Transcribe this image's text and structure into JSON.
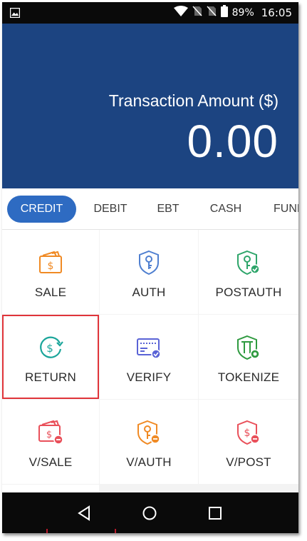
{
  "status_bar": {
    "battery_percent": "89%",
    "time": "16:05"
  },
  "header": {
    "amount_label": "Transaction Amount ($)",
    "amount_value": "0.00"
  },
  "tabs": [
    {
      "label": "CREDIT",
      "active": true
    },
    {
      "label": "DEBIT",
      "active": false
    },
    {
      "label": "EBT",
      "active": false
    },
    {
      "label": "CASH",
      "active": false
    },
    {
      "label": "FUNDING",
      "active": false
    }
  ],
  "actions": [
    {
      "label": "SALE",
      "icon": "wallet-dollar-icon",
      "color": "#f08a24"
    },
    {
      "label": "AUTH",
      "icon": "shield-key-icon",
      "color": "#4f7fd0"
    },
    {
      "label": "POSTAUTH",
      "icon": "shield-key-check-icon",
      "color": "#2ea56a"
    },
    {
      "label": "RETURN",
      "icon": "dollar-return-icon",
      "color": "#1aa59a",
      "selected": true
    },
    {
      "label": "VERIFY",
      "icon": "card-verify-icon",
      "color": "#5a63d6"
    },
    {
      "label": "TOKENIZE",
      "icon": "shield-token-icon",
      "color": "#2e9a3f"
    },
    {
      "label": "V/SALE",
      "icon": "wallet-void-icon",
      "color": "#e9505a"
    },
    {
      "label": "V/AUTH",
      "icon": "shield-key-void-icon",
      "color": "#f08a24"
    },
    {
      "label": "V/POST",
      "icon": "shield-dollar-void-icon",
      "color": "#e9505a"
    }
  ],
  "colors": {
    "header_bg": "#1c4481",
    "active_tab_bg": "#2e6bc2",
    "selected_outline": "#e0343a"
  }
}
